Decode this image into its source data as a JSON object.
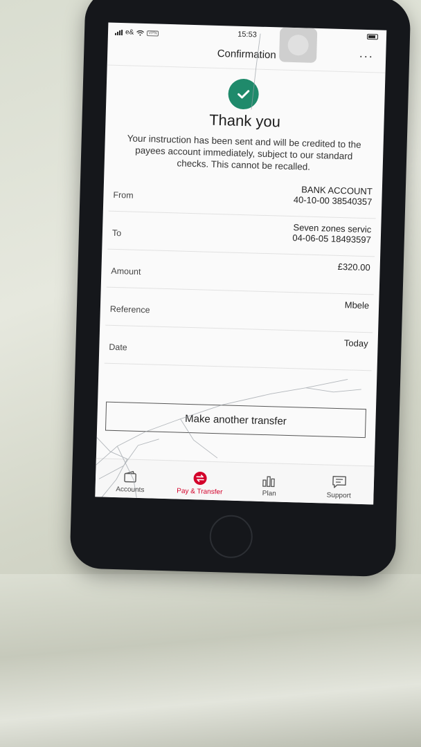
{
  "status": {
    "carrier": "e&",
    "vpn": "VPN",
    "time": "15:53"
  },
  "header": {
    "title": "Confirmation"
  },
  "confirmation": {
    "heading": "Thank you",
    "message": "Your instruction has been sent and will be credited to the payees account immediately, subject to our standard checks.  This cannot be recalled."
  },
  "details": [
    {
      "label": "From",
      "value_line1": "BANK ACCOUNT",
      "value_line2": "40-10-00 38540357"
    },
    {
      "label": "To",
      "value_line1": "Seven zones servic",
      "value_line2": "04-06-05 18493597"
    },
    {
      "label": "Amount",
      "value_line1": "£320.00",
      "value_line2": ""
    },
    {
      "label": "Reference",
      "value_line1": "Mbele",
      "value_line2": ""
    },
    {
      "label": "Date",
      "value_line1": "Today",
      "value_line2": ""
    }
  ],
  "actions": {
    "make_another_transfer": "Make another transfer"
  },
  "tabs": [
    {
      "label": "Accounts",
      "icon": "wallet-icon",
      "active": false
    },
    {
      "label": "Pay & Transfer",
      "icon": "transfer-icon",
      "active": true
    },
    {
      "label": "Plan",
      "icon": "bar-chart-icon",
      "active": false
    },
    {
      "label": "Support",
      "icon": "chat-icon",
      "active": false
    }
  ],
  "colors": {
    "success": "#1f8a6b",
    "active_tab": "#d3002a",
    "phone_body": "#15171b"
  }
}
